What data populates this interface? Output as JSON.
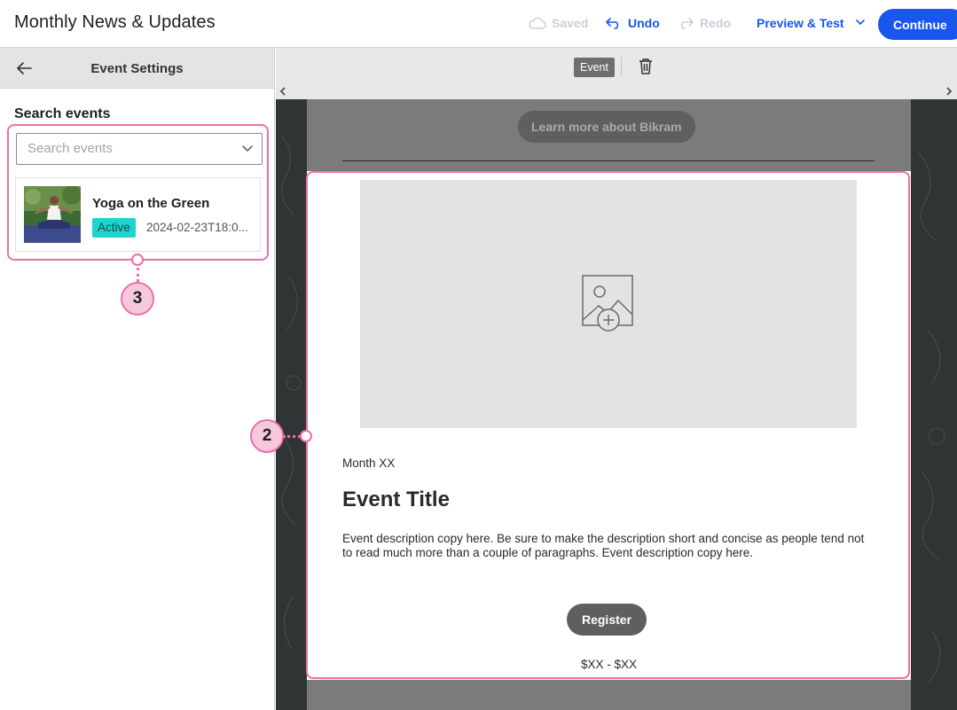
{
  "header": {
    "title": "Monthly News & Updates",
    "saved_label": "Saved",
    "undo_label": "Undo",
    "redo_label": "Redo",
    "preview_label": "Preview & Test",
    "continue_label": "Continue"
  },
  "left_panel": {
    "title": "Event Settings",
    "search_label": "Search events",
    "search_placeholder": "Search events",
    "events": [
      {
        "name": "Yoga on the Green",
        "status": "Active",
        "date": "2024-02-23T18:0..."
      }
    ]
  },
  "canvas": {
    "selected_element_tag": "Event",
    "learn_more_label": "Learn more about Bikram",
    "event_block": {
      "month": "Month XX",
      "title": "Event Title",
      "description": "Event description copy here. Be sure to make the description short and concise as people tend not to read much more than a couple of paragraphs. Event description copy here.",
      "register_label": "Register",
      "price": "$XX - $XX"
    }
  },
  "callouts": [
    "2",
    "3"
  ],
  "colors": {
    "accent_blue": "#1856ed",
    "highlight_pink": "#ee6fa7",
    "active_badge": "#1fd4cf",
    "canvas_dark": "#2f3434"
  }
}
